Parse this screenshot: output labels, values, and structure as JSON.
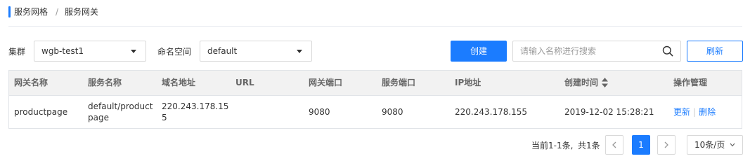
{
  "breadcrumb": {
    "parent": "服务网格",
    "separator": "/",
    "current": "服务网关"
  },
  "filters": {
    "cluster_label": "集群",
    "cluster_value": "wgb-test1",
    "namespace_label": "命名空间",
    "namespace_value": "default"
  },
  "toolbar": {
    "create_label": "创建",
    "search_placeholder": "请输入名称进行搜索",
    "search_icon": "search-icon",
    "refresh_label": "刷新"
  },
  "table": {
    "columns": [
      "网关名称",
      "服务名称",
      "域名地址",
      "URL",
      "网关端口",
      "服务端口",
      "IP地址",
      "创建时间",
      "操作管理"
    ],
    "rows": [
      {
        "gateway_name": "productpage",
        "service_name": "default/productpage",
        "service_name_line1": "default/product",
        "service_name_line2": "page",
        "domain": "220.243.178.155",
        "domain_line1": "220.243.178.15",
        "domain_line2": "5",
        "url": "",
        "gateway_port": "9080",
        "service_port": "9080",
        "ip": "220.243.178.155",
        "created": "2019-12-02 15:28:21",
        "action_update": "更新",
        "action_sep": "|",
        "action_delete": "删除"
      }
    ]
  },
  "pagination": {
    "summary": "当前1-1条,",
    "total": "共1条",
    "current_page": "1",
    "page_size": "10条/页"
  },
  "colors": {
    "accent": "#1b7cff",
    "header_bg": "#f2f2f2",
    "border": "#e1e4e8"
  }
}
